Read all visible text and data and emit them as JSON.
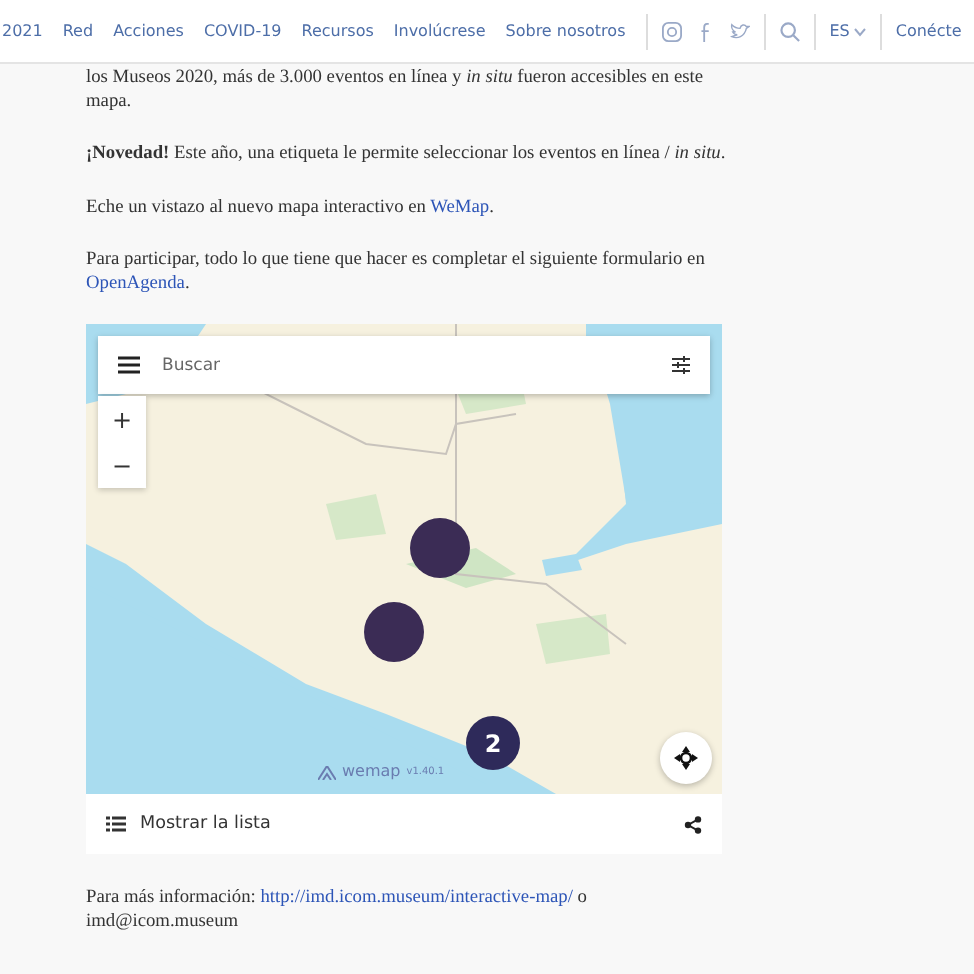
{
  "nav": {
    "items": [
      "2021",
      "Red",
      "Acciones",
      "COVID-19",
      "Recursos",
      "Involúcrese",
      "Sobre nosotros"
    ],
    "language": "ES",
    "login": "Conécte"
  },
  "paragraphs": [
    {
      "text": "los Museos 2020, más de 3.000 eventos en línea y *in situ* fueron accesibles en este mapa."
    },
    {
      "text": "**¡Novedad!** Este año, una etiqueta le permite seleccionar los eventos en línea / *in situ*."
    },
    {
      "text": "Eche un vistazo al nuevo mapa interactivo en ",
      "link": "WeMap",
      "after": "."
    },
    {
      "text": "Para participar, todo lo que tiene que hacer es completar el siguiente formulario en ",
      "link": "OpenAgenda",
      "after": "."
    }
  ],
  "map": {
    "search": {
      "placeholder": "Buscar"
    },
    "zoom_in": "+",
    "zoom_out": "−",
    "cluster": "2",
    "brand": "wemap",
    "version": "v1.40.1",
    "list_button": "Mostrar la lista"
  },
  "footer_paragraph": {
    "text": "Para más información: ",
    "link": "http://imd.icom.museum/interactive-map/",
    "after": " o",
    "line2": "imd@icom.museum"
  }
}
